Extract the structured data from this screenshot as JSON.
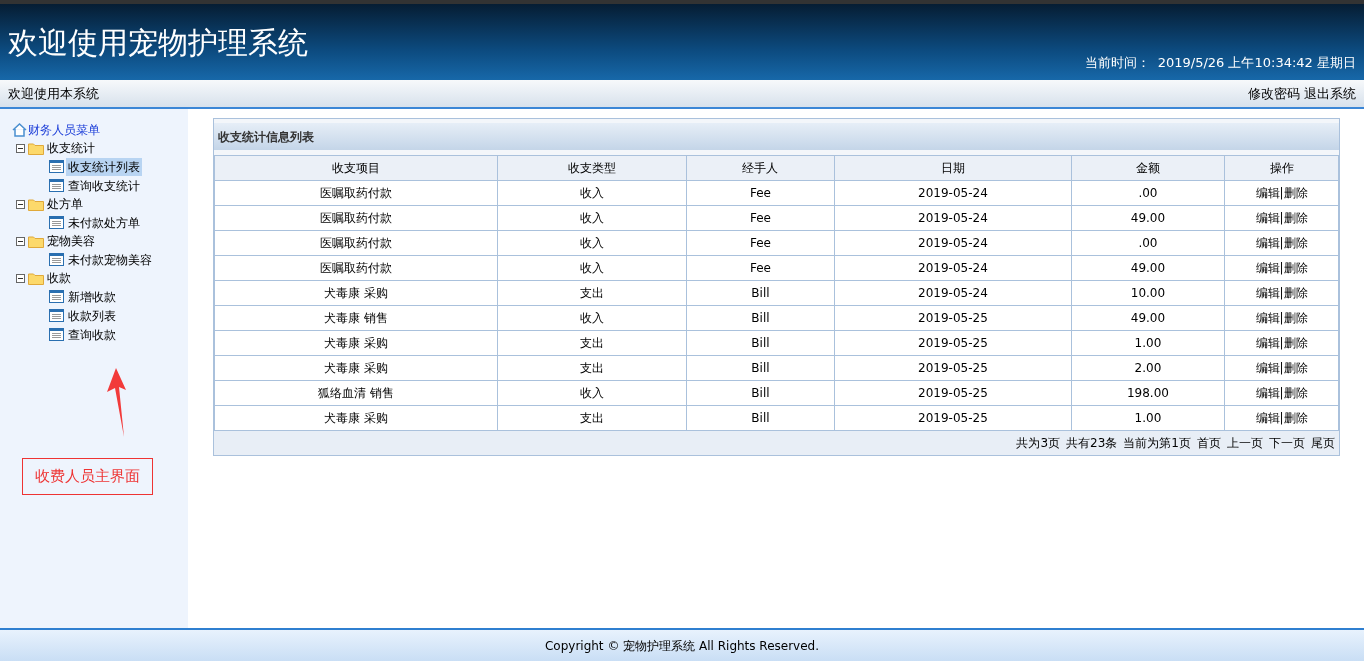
{
  "header": {
    "title": "欢迎使用宠物护理系统",
    "time_label": "当前时间：",
    "time_value": "2019/5/26 上午10:34:42 星期日"
  },
  "nav_bar": {
    "welcome": "欢迎使用本系统",
    "links": [
      "修改密码",
      "退出系统"
    ]
  },
  "sidebar": {
    "root": "财务人员菜单",
    "groups": [
      {
        "label": "收支统计",
        "expanded": true,
        "children": [
          {
            "label": "收支统计列表",
            "selected": true
          },
          {
            "label": "查询收支统计",
            "selected": false
          }
        ]
      },
      {
        "label": "处方单",
        "expanded": true,
        "children": [
          {
            "label": "未付款处方单",
            "selected": false
          }
        ]
      },
      {
        "label": "宠物美容",
        "expanded": true,
        "children": [
          {
            "label": "未付款宠物美容",
            "selected": false
          }
        ]
      },
      {
        "label": "收款",
        "expanded": true,
        "children": [
          {
            "label": "新增收款",
            "selected": false
          },
          {
            "label": "收款列表",
            "selected": false
          },
          {
            "label": "查询收款",
            "selected": false
          }
        ]
      }
    ],
    "annotation": "收费人员主界面"
  },
  "panel": {
    "title": "收支统计信息列表"
  },
  "table": {
    "columns": [
      "收支项目",
      "收支类型",
      "经手人",
      "日期",
      "金额",
      "操作"
    ],
    "rows": [
      {
        "cells": [
          "医嘱取药付款",
          "收入",
          "Fee",
          "2019-05-24",
          ".00"
        ],
        "actions": [
          "编辑",
          "删除"
        ],
        "separator": "|"
      },
      {
        "cells": [
          "医嘱取药付款",
          "收入",
          "Fee",
          "2019-05-24",
          "49.00"
        ],
        "actions": [
          "编辑",
          "删除"
        ],
        "separator": "|"
      },
      {
        "cells": [
          "医嘱取药付款",
          "收入",
          "Fee",
          "2019-05-24",
          ".00"
        ],
        "actions": [
          "编辑",
          "删除"
        ],
        "separator": "|"
      },
      {
        "cells": [
          "医嘱取药付款",
          "收入",
          "Fee",
          "2019-05-24",
          "49.00"
        ],
        "actions": [
          "编辑",
          "删除"
        ],
        "separator": "|"
      },
      {
        "cells": [
          "犬毒康 采购",
          "支出",
          "Bill",
          "2019-05-24",
          "10.00"
        ],
        "actions": [
          "编辑",
          "删除"
        ],
        "separator": "|"
      },
      {
        "cells": [
          "犬毒康 销售",
          "收入",
          "Bill",
          "2019-05-25",
          "49.00"
        ],
        "actions": [
          "编辑",
          "删除"
        ],
        "separator": "|"
      },
      {
        "cells": [
          "犬毒康 采购",
          "支出",
          "Bill",
          "2019-05-25",
          "1.00"
        ],
        "actions": [
          "编辑",
          "删除"
        ],
        "separator": "|"
      },
      {
        "cells": [
          "犬毒康 采购",
          "支出",
          "Bill",
          "2019-05-25",
          "2.00"
        ],
        "actions": [
          "编辑",
          "删除"
        ],
        "separator": "|"
      },
      {
        "cells": [
          "狐络血清 销售",
          "收入",
          "Bill",
          "2019-05-25",
          "198.00"
        ],
        "actions": [
          "编辑",
          "删除"
        ],
        "separator": "|"
      },
      {
        "cells": [
          "犬毒康 采购",
          "支出",
          "Bill",
          "2019-05-25",
          "1.00"
        ],
        "actions": [
          "编辑",
          "删除"
        ],
        "separator": "|"
      }
    ]
  },
  "pagination": {
    "info": [
      "共为3页",
      "共有23条",
      "当前为第1页"
    ],
    "links": [
      "首页",
      "上一页",
      "下一页",
      "尾页"
    ]
  },
  "footer": {
    "copyright": "Copyright © 宠物护理系统 All Rights Reserved."
  }
}
